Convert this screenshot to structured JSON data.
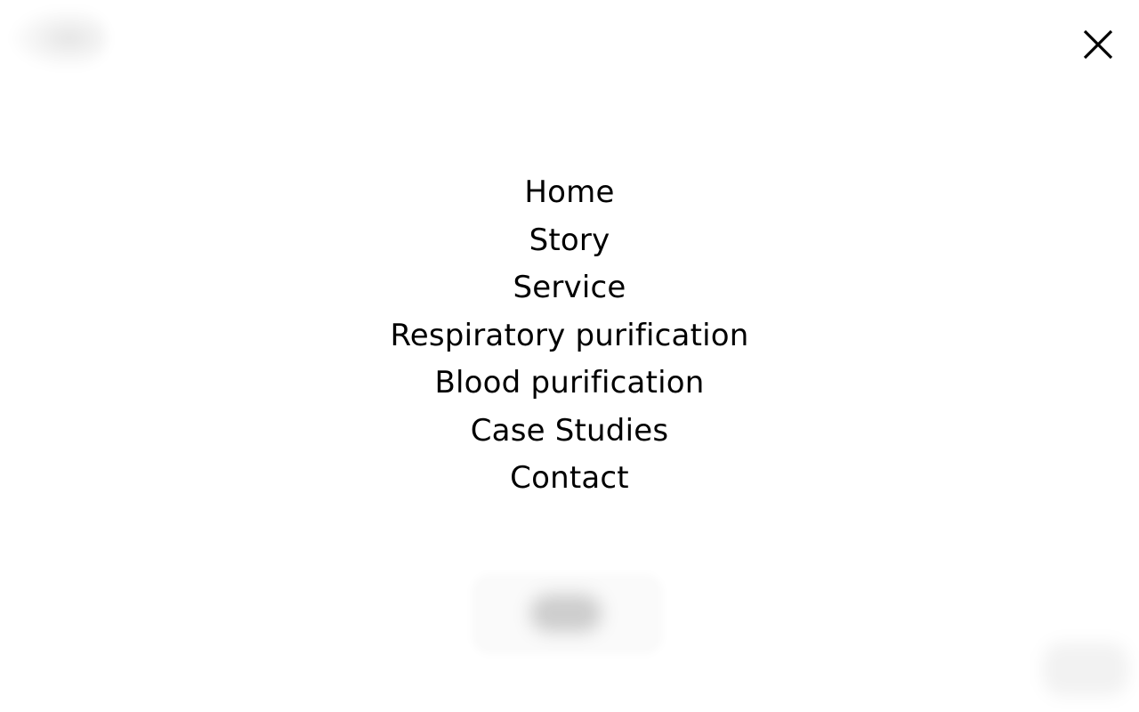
{
  "colors": {
    "background": "#ffffff",
    "text": "#000000"
  },
  "close_button": {
    "icon": "close-icon"
  },
  "menu": {
    "items": [
      {
        "label": "Home"
      },
      {
        "label": "Story"
      },
      {
        "label": "Service"
      },
      {
        "label": "Respiratory purification"
      },
      {
        "label": "Blood purification"
      },
      {
        "label": "Case Studies"
      },
      {
        "label": "Contact"
      }
    ]
  }
}
